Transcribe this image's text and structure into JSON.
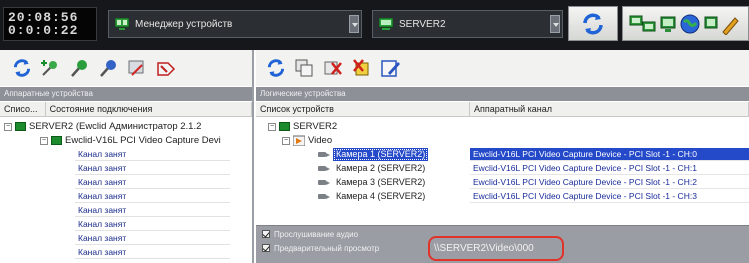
{
  "topbar": {
    "clock": {
      "line1": "20:08:56",
      "line2": "0:0:0:22"
    },
    "device_manager_combo": {
      "label": "Менеджер устройств",
      "icon": "device-manager-icon"
    },
    "server_combo": {
      "label": "SERVER2",
      "icon": "server-monitor-icon"
    },
    "refresh_button": {
      "icon": "refresh-arrows-icon"
    },
    "tools": [
      "device-manager-icon",
      "monitor-icon",
      "globe-icon",
      "monitor-icon",
      "pencil-icon"
    ]
  },
  "left_pane": {
    "toolbar_icons": [
      "refresh-arrows-icon",
      "add-device-icon",
      "connect-device-icon",
      "disconnect-device-icon",
      "device-settings-icon",
      "tag-icon"
    ],
    "header": "Аппаратные устройства",
    "columns": [
      "Списо...",
      "Состояние подключения"
    ],
    "tree": {
      "server": {
        "label": "SERVER2 (Ewclid Администратор 2.1.2",
        "expander": "−"
      },
      "device": {
        "label": "Ewclid-V16L PCI Video Capture Devi",
        "expander": "−"
      },
      "channels": [
        "Канал занят",
        "Канал занят",
        "Канал занят",
        "Канал занят",
        "Канал занят",
        "Канал занят",
        "Канал занят",
        "Канал занят"
      ]
    }
  },
  "right_pane": {
    "toolbar_icons": [
      "refresh-arrows-icon",
      "copy-device-icon",
      "delete-device-icon",
      "delete-all-icon",
      "edit-icon"
    ],
    "header": "Логические устройства",
    "columns": [
      "Список устройств",
      "Аппаратный канал"
    ],
    "tree": {
      "server": {
        "label": "SERVER2",
        "expander": "−"
      },
      "video": {
        "label": "Video",
        "expander": "−"
      },
      "cameras": [
        {
          "name": "Камера 1 (SERVER2)",
          "channel": "Ewclid-V16L PCI Video Capture Device - PCI Slot -1 - CH:0",
          "selected": true
        },
        {
          "name": "Камера 2 (SERVER2)",
          "channel": "Ewclid-V16L PCI Video Capture Device - PCI Slot -1 - CH:1",
          "selected": false
        },
        {
          "name": "Камера 3 (SERVER2)",
          "channel": "Ewclid-V16L PCI Video Capture Device - PCI Slot -1 - CH:2",
          "selected": false
        },
        {
          "name": "Камера 4 (SERVER2)",
          "channel": "Ewclid-V16L PCI Video Capture Device - PCI Slot -1 - CH:3",
          "selected": false
        }
      ]
    },
    "options": {
      "audio_label": "Прослушивание аудио",
      "preview_label": "Предварительный просмотр",
      "preview_path": "\\\\SERVER2\\Video\\000",
      "audio_checked": true,
      "preview_checked": true
    }
  },
  "colors": {
    "topbar_bg": "#15171b",
    "header_bg": "#8d9097",
    "selection": "#2449c9",
    "channel_text": "#1a2c9a",
    "highlight_ring": "#e0332a"
  }
}
